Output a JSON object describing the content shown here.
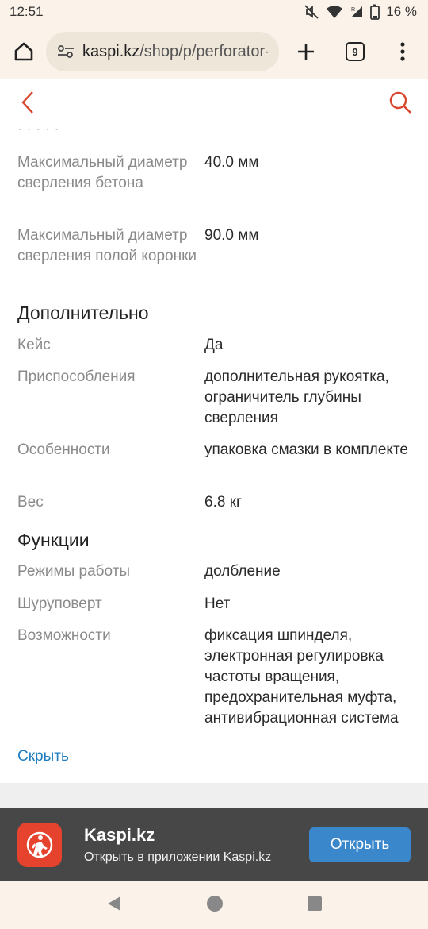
{
  "status": {
    "time": "12:51",
    "battery": "16 %"
  },
  "browser": {
    "url_host": "kaspi.kz",
    "url_path": "/shop/p/perforator-",
    "tab_count": "9"
  },
  "specs": {
    "cut_row_text": "· · · · ·",
    "rows_top": [
      {
        "label": "Максимальный диаметр сверления бетона",
        "value": "40.0 мм"
      },
      {
        "label": "Максимальный диаметр сверления полой коронки",
        "value": "90.0 мм"
      }
    ],
    "section_additional": "Дополнительно",
    "rows_additional": [
      {
        "label": "Кейс",
        "value": "Да"
      },
      {
        "label": "Приспособления",
        "value": "дополнительная рукоятка, ограничитель глубины сверления"
      },
      {
        "label": "Особенности",
        "value": "упаковка смазки в комплекте"
      },
      {
        "label": "Вес",
        "value": "6.8 кг"
      }
    ],
    "section_functions": "Функции",
    "rows_functions": [
      {
        "label": "Режимы работы",
        "value": "долбление"
      },
      {
        "label": "Шуруповерт",
        "value": "Нет"
      },
      {
        "label": "Возможности",
        "value": "фиксация шпинделя, электронная регулировка частоты вращения, предохранительная муфта, антивибрационная система"
      }
    ],
    "hide_link": "Скрыть"
  },
  "banner": {
    "app_name": "Kaspi.kz",
    "subtitle": "Открыть в приложении Kaspi.kz",
    "open_button": "Открыть"
  },
  "colors": {
    "accent_red": "#d9472f",
    "link_blue": "#1f7dc0",
    "button_blue": "#3b87cc"
  }
}
